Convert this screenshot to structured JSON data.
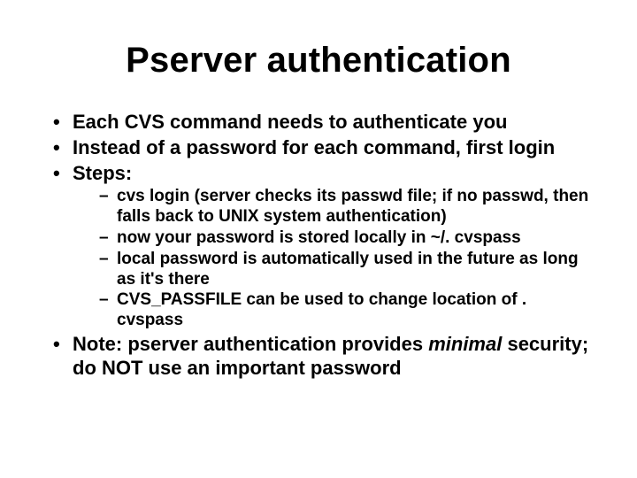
{
  "title": "Pserver authentication",
  "bullets": {
    "b0": "Each CVS command needs to authenticate you",
    "b1": "Instead of a password for each command, first login",
    "b2": "Steps:",
    "sub": {
      "s0": "cvs login (server checks its passwd file; if no passwd, then falls back to UNIX system authentication)",
      "s1": "now your password is stored locally in ~/. cvspass",
      "s2": "local password is automatically used in the future as long as it's there",
      "s3": "CVS_PASSFILE can be used to change location of . cvspass"
    },
    "note_pre": "Note:  pserver authentication provides ",
    "note_ital": "minimal",
    "note_post": " security; do NOT use an important password"
  }
}
